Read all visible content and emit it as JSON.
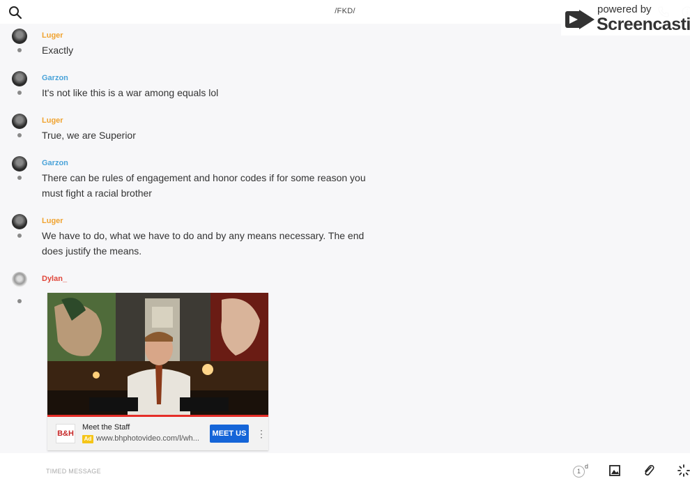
{
  "header": {
    "room_title": "/FKD/"
  },
  "watermark": {
    "line1": "powered by",
    "line2": "Screencastify"
  },
  "messages": [
    {
      "author": "Luger",
      "text": "Exactly"
    },
    {
      "author": "Garzon",
      "text": "It's not like this is a war among equals lol"
    },
    {
      "author": "Luger",
      "text": "True, we are Superior"
    },
    {
      "author": "Garzon",
      "text": "There can be rules of engagement and honor codes if for some reason you must fight a racial brother"
    },
    {
      "author": "Luger",
      "text": "We have to do, what we have to do and by any means necessary. The end does justify the means."
    },
    {
      "author": "Dylan_",
      "text": ""
    }
  ],
  "embed": {
    "ad_logo": "B&H",
    "ad_title": "Meet the Staff",
    "ad_badge": "Ad",
    "ad_url": "www.bhphotovideo.com/l/wh...",
    "cta_label": "MEET US",
    "more_label": "⋮"
  },
  "composer": {
    "placeholder": "TIMED MESSAGE",
    "ttl_value": "1",
    "ttl_unit": "d"
  },
  "colors": {
    "luger": "#f0a330",
    "garzon": "#4aa3d9",
    "dylan": "#e0463a",
    "cta": "#1565d8"
  }
}
